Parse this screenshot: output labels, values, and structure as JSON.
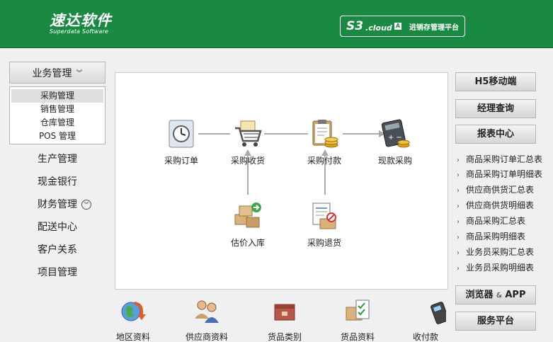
{
  "header": {
    "brand_name": "速达软件",
    "brand_sub": "Superdata Software",
    "product_s3": "S3",
    "product_cloud": ".cloud",
    "product_badge": "A",
    "product_tag": "进销存管理平台"
  },
  "sidebar": {
    "business_label": "业务管理",
    "submenu": [
      "采购管理",
      "销售管理",
      "仓库管理",
      "POS 管理"
    ],
    "items": [
      "生产管理",
      "现金银行",
      "财务管理",
      "配送中心",
      "客户关系",
      "项目管理"
    ]
  },
  "flow": {
    "purchase_order": "采购订单",
    "purchase_receive": "采购收货",
    "purchase_payment": "采购付款",
    "cash_purchase": "现款采购",
    "estimate_stock_in": "估价入库",
    "purchase_return": "采购退货"
  },
  "bottom": [
    "地区资料",
    "供应商资料",
    "货品类别",
    "货品资料",
    "收付款"
  ],
  "right": {
    "h5": "H5移动端",
    "manager_query": "经理查询",
    "report_center": "报表中心",
    "reports": [
      "商品采购订单汇总表",
      "商品采购订单明细表",
      "供应商供货汇总表",
      "供应商供货明细表",
      "商品采购汇总表",
      "商品采购明细表",
      "业务员采购汇总表",
      "业务员采购明细表"
    ],
    "browser_label": "浏览器",
    "browser_amp": "&",
    "browser_app": "APP",
    "service": "服务平台"
  },
  "colors": {
    "brand_green": "#1a8a42",
    "panel_bg": "#f0f0f0"
  }
}
